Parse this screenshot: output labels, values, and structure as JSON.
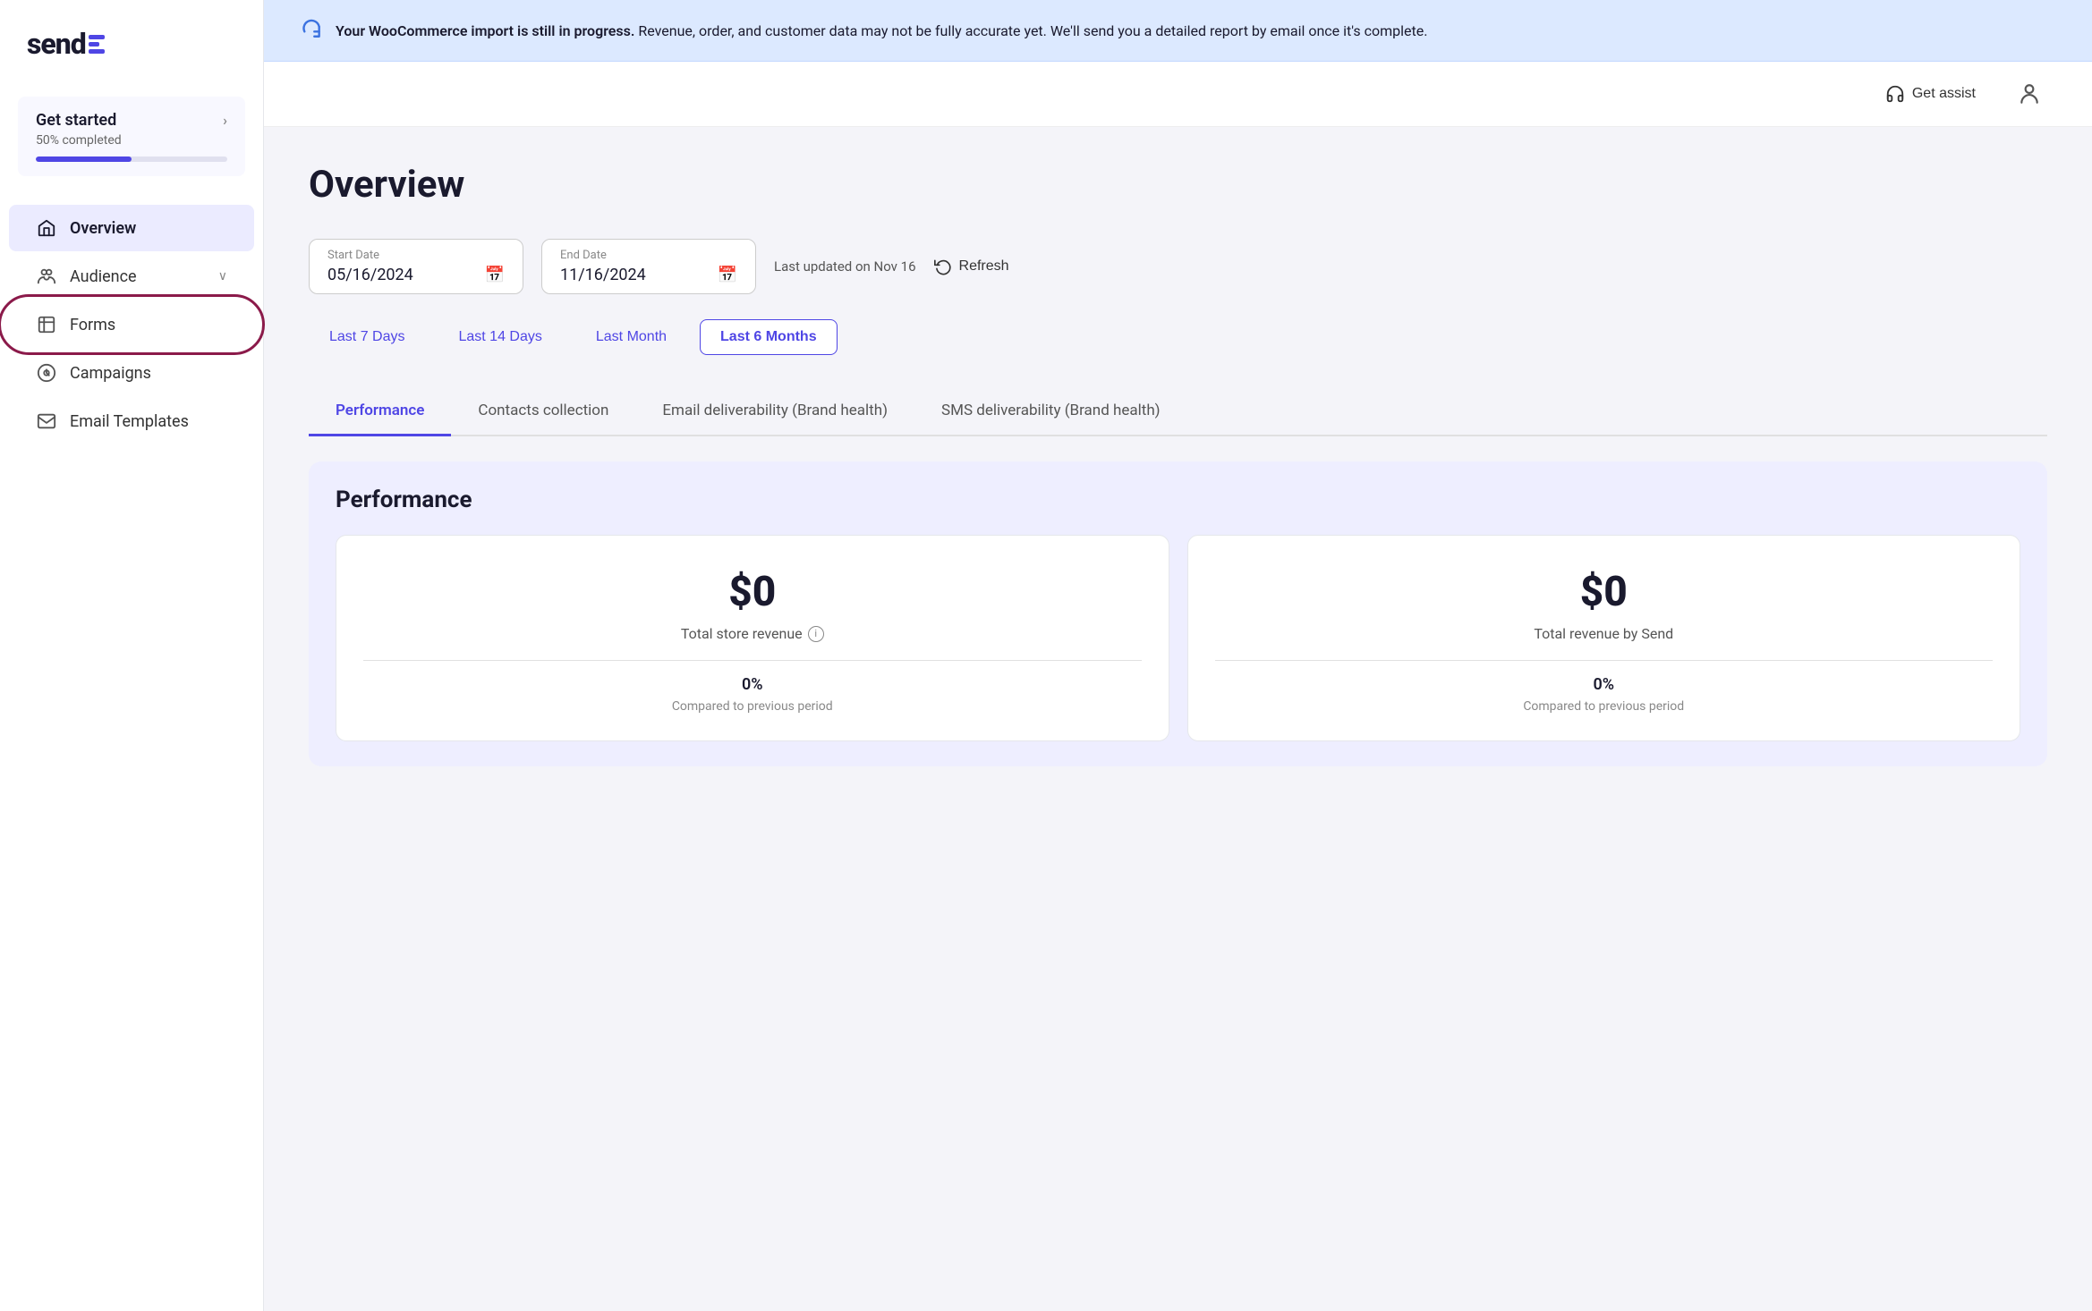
{
  "app": {
    "logo_text": "send",
    "get_started_label": "Get started",
    "progress_label": "50% completed",
    "progress_pct": 50
  },
  "banner": {
    "text_bold": "Your WooCommerce import is still in progress.",
    "text_rest": "Revenue, order, and customer data may not be fully accurate yet. We'll send you a detailed report by email once it's complete."
  },
  "header": {
    "get_assist_label": "Get assist"
  },
  "sidebar": {
    "items": [
      {
        "id": "overview",
        "label": "Overview",
        "active": true
      },
      {
        "id": "audience",
        "label": "Audience",
        "has_chevron": true
      },
      {
        "id": "forms",
        "label": "Forms",
        "circled": true
      },
      {
        "id": "campaigns",
        "label": "Campaigns"
      },
      {
        "id": "email-templates",
        "label": "Email Templates"
      }
    ]
  },
  "main": {
    "page_title": "Overview",
    "date_start_label": "Start Date",
    "date_start_value": "05/16/2024",
    "date_end_label": "End Date",
    "date_end_value": "11/16/2024",
    "last_updated": "Last updated on Nov 16",
    "refresh_label": "Refresh",
    "pills": [
      {
        "label": "Last 7 Days",
        "active": false
      },
      {
        "label": "Last 14 Days",
        "active": false
      },
      {
        "label": "Last Month",
        "active": false
      },
      {
        "label": "Last 6 Months",
        "active": true
      }
    ],
    "tabs": [
      {
        "label": "Performance",
        "active": true
      },
      {
        "label": "Contacts collection",
        "active": false
      },
      {
        "label": "Email deliverability (Brand health)",
        "active": false
      },
      {
        "label": "SMS deliverability (Brand health)",
        "active": false
      }
    ],
    "performance_section": {
      "title": "Performance",
      "cards": [
        {
          "value": "$0",
          "label": "Total store revenue",
          "has_info": true,
          "pct": "0%",
          "compare": "Compared to previous period"
        },
        {
          "value": "$0",
          "label": "Total revenue by Send",
          "has_info": false,
          "pct": "0%",
          "compare": "Compared to previous period"
        }
      ]
    }
  }
}
